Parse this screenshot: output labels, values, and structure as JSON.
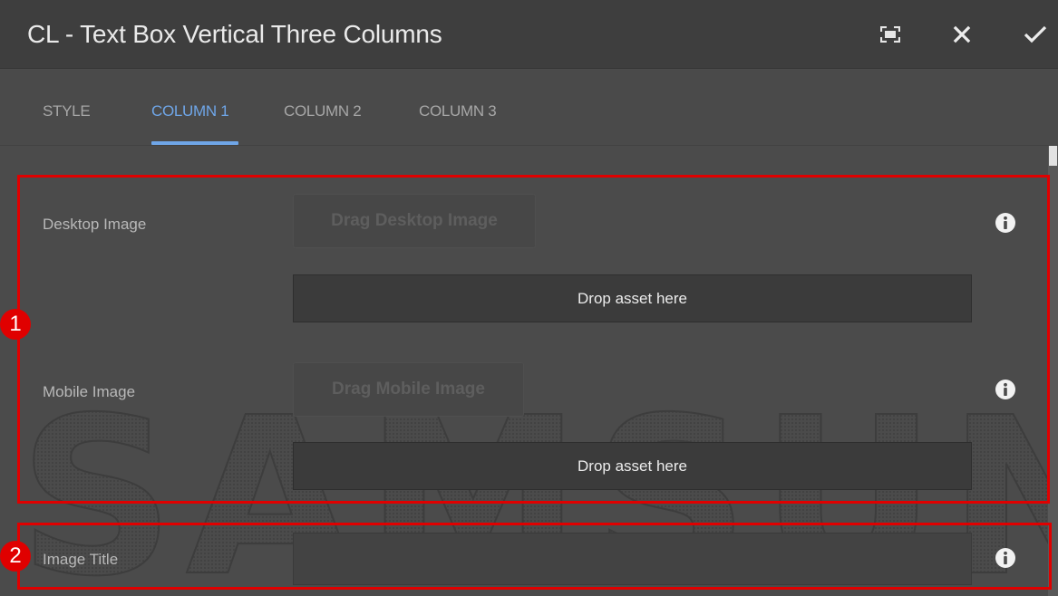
{
  "dialog": {
    "title": "CL - Text Box Vertical Three Columns",
    "icons": {
      "fullscreen": "fullscreen-icon",
      "close": "close-icon",
      "confirm": "check-icon"
    }
  },
  "tabs": [
    {
      "label": "STYLE",
      "active": false
    },
    {
      "label": "COLUMN 1",
      "active": true
    },
    {
      "label": "COLUMN 2",
      "active": false
    },
    {
      "label": "COLUMN 3",
      "active": false
    }
  ],
  "fields": {
    "desktop_image": {
      "label": "Desktop Image",
      "drag_label": "Drag Desktop Image",
      "drop_text": "Drop asset here"
    },
    "mobile_image": {
      "label": "Mobile Image",
      "drag_label": "Drag Mobile Image",
      "drop_text": "Drop asset here"
    },
    "image_title": {
      "label": "Image Title",
      "value": ""
    }
  },
  "watermark": {
    "text": "SAMSUNG"
  },
  "annotations": [
    {
      "number": "1"
    },
    {
      "number": "2"
    }
  ],
  "colors": {
    "accent": "#6fa6e8",
    "annotation_red": "#e00000",
    "background": "#4b4b4b",
    "header": "#3e3e3e"
  }
}
